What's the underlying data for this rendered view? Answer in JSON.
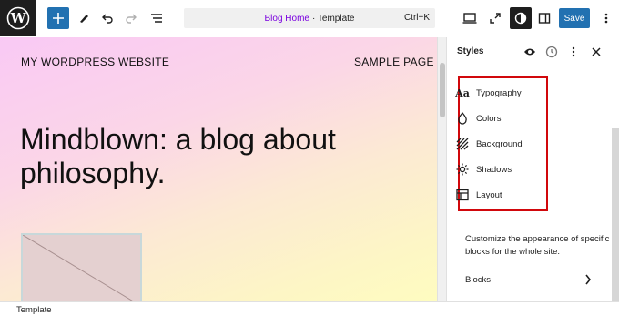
{
  "toolbar": {
    "document_title": "Blog Home",
    "document_type": "· Template",
    "shortcut": "Ctrl+K",
    "save_label": "Save",
    "icons": [
      "wordpress-logo",
      "plus-icon",
      "pen-icon",
      "undo-icon",
      "redo-icon",
      "list-view-icon",
      "desktop-icon",
      "external-link-icon",
      "contrast-icon",
      "sidebar-icon",
      "kebab-menu-icon"
    ]
  },
  "canvas": {
    "site_title": "MY WORDPRESS WEBSITE",
    "nav_link": "SAMPLE PAGE",
    "headline": "Mindblown: a blog about philosophy."
  },
  "sidebar": {
    "title": "Styles",
    "menu": [
      {
        "label": "Typography",
        "icon": "typography-icon"
      },
      {
        "label": "Colors",
        "icon": "droplet-icon"
      },
      {
        "label": "Background",
        "icon": "background-icon"
      },
      {
        "label": "Shadows",
        "icon": "sun-icon"
      },
      {
        "label": "Layout",
        "icon": "layout-icon"
      }
    ],
    "description": "Customize the appearance of specific blocks for the whole site.",
    "blocks_label": "Blocks",
    "highlight_color": "#d1080c"
  },
  "footer": {
    "label": "Template"
  },
  "colors": {
    "accent": "#2271b1",
    "dark": "#1e1e1e"
  }
}
